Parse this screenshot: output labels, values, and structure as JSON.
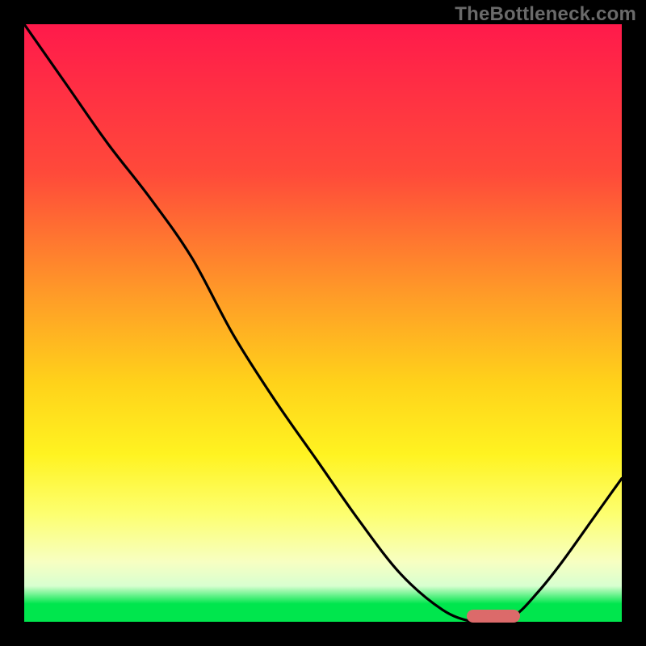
{
  "watermark": "TheBottleneck.com",
  "colors": {
    "page_bg": "#000000",
    "gradient_top": "#ff1a4b",
    "gradient_bottom": "#00e64d",
    "curve": "#000000",
    "marker": "#dc6a6a",
    "watermark": "#6a6a6a"
  },
  "chart_data": {
    "type": "line",
    "title": "",
    "xlabel": "",
    "ylabel": "",
    "xlim": [
      0,
      100
    ],
    "ylim": [
      0,
      100
    ],
    "grid": false,
    "legend": false,
    "series": [
      {
        "name": "bottleneck-curve",
        "x": [
          0,
          7,
          14,
          21,
          28,
          35,
          42,
          49,
          56,
          63,
          70,
          75,
          78,
          82,
          86,
          90,
          95,
          100
        ],
        "y": [
          100,
          90,
          80,
          71,
          61,
          48,
          37,
          27,
          17,
          8,
          2,
          0,
          0,
          1,
          5,
          10,
          17,
          24
        ]
      }
    ],
    "marker": {
      "x_start": 74,
      "x_end": 83,
      "y": 1
    },
    "background_gradient": {
      "direction": "vertical",
      "stops": [
        {
          "pos": 0.0,
          "color": "#ff1a4b"
        },
        {
          "pos": 0.25,
          "color": "#ff4a3a"
        },
        {
          "pos": 0.45,
          "color": "#ff9a28"
        },
        {
          "pos": 0.6,
          "color": "#ffd21a"
        },
        {
          "pos": 0.72,
          "color": "#fff321"
        },
        {
          "pos": 0.82,
          "color": "#fdff70"
        },
        {
          "pos": 0.9,
          "color": "#f7ffc2"
        },
        {
          "pos": 0.94,
          "color": "#d8ffd0"
        },
        {
          "pos": 0.97,
          "color": "#00e64d"
        },
        {
          "pos": 1.0,
          "color": "#00e64d"
        }
      ]
    }
  }
}
